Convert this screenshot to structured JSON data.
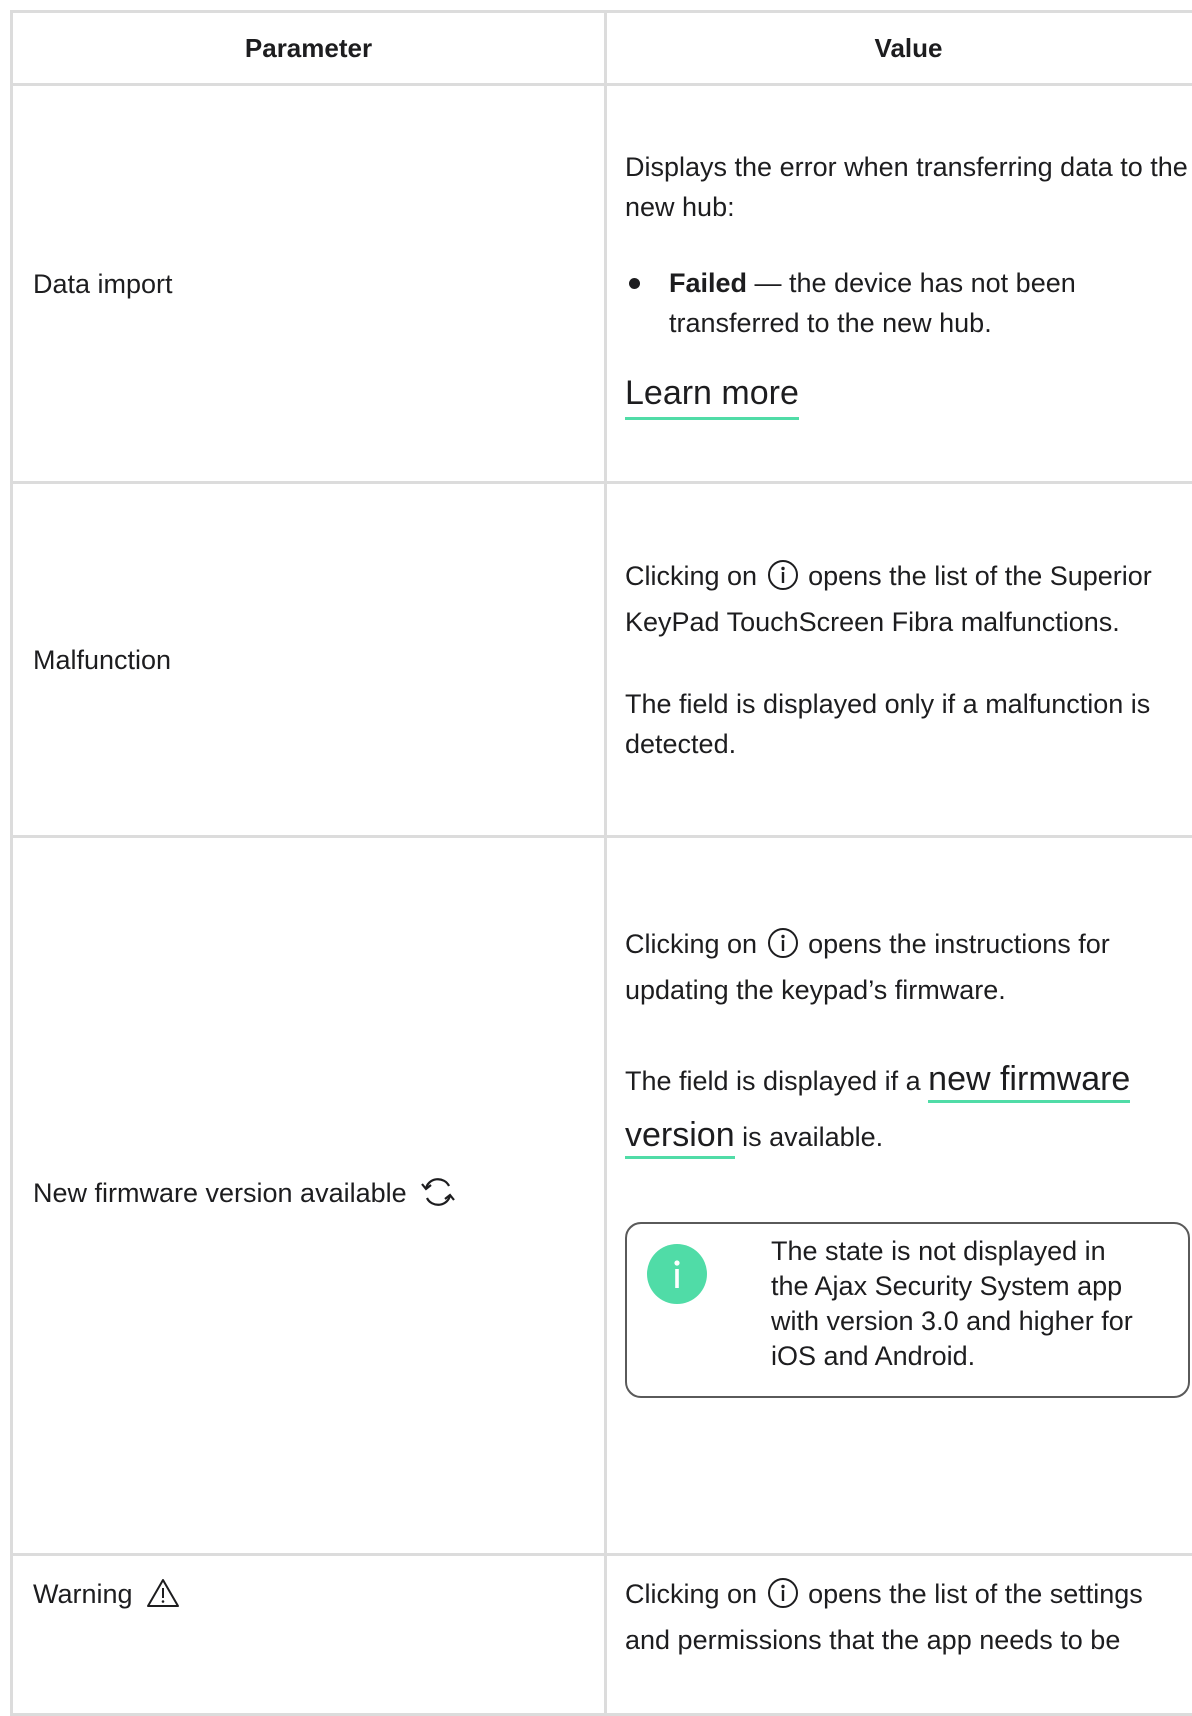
{
  "table": {
    "headers": [
      "Parameter",
      "Value"
    ],
    "rows": [
      {
        "param": "Data import",
        "intro": "Displays the error when transferring data to the new hub:",
        "bullet_bold": "Failed",
        "bullet_rest": " — the device has not been transferred to the new hub.",
        "link": "Learn more"
      },
      {
        "param": "Malfunction",
        "p1_before": "Clicking on",
        "p1_after": "opens the list of the Superior KeyPad TouchScreen Fibra malfunctions.",
        "p2": "The field is displayed only if a malfunction is detected."
      },
      {
        "param": "New firmware version available",
        "param_icon": "refresh-icon",
        "p1_before": "Clicking on",
        "p1_after": "opens the instructions for updating the keypad’s firmware.",
        "p2_before": "The field is displayed if a ",
        "p2_link": "new firmware version",
        "p2_after": " is available.",
        "note_icon": "info-icon",
        "note": "The state is not displayed in the Ajax Security System app with version 3.0 and higher for iOS and Android."
      },
      {
        "param": "Warning",
        "param_icon": "warning-triangle-icon",
        "p1_before": "Clicking on",
        "p1_after": "opens the list of the settings and permissions that the app needs to be"
      }
    ]
  },
  "colors": {
    "accent": "#50dca7",
    "border": "#dcdcdc",
    "text": "#1d1d1f"
  },
  "icons": {
    "info_inline": "info-circle-icon"
  }
}
